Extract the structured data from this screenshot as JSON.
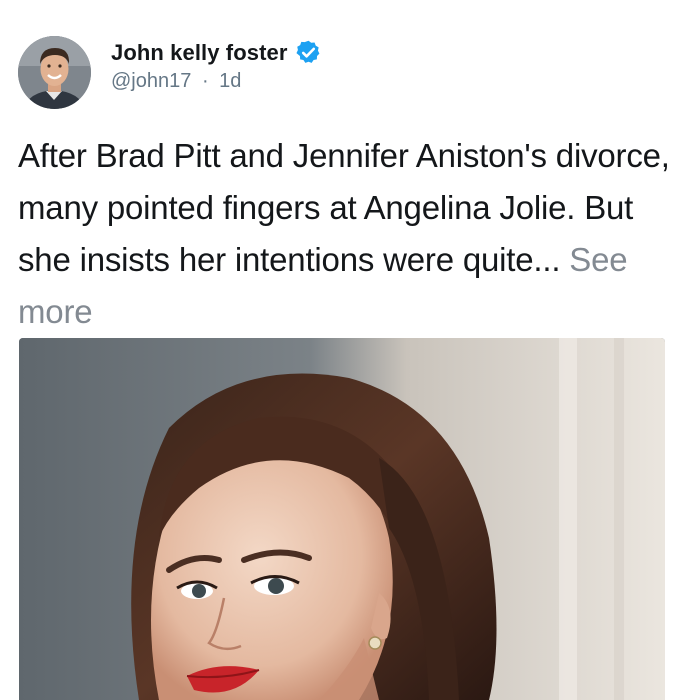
{
  "post": {
    "author": {
      "name": "John kelly foster",
      "verified": true,
      "handle": "@john17",
      "separator": "·",
      "time": "1d"
    },
    "text": "After Brad Pitt and Jennifer Aniston's divorce, many pointed fingers at Angelina Jolie. But she insists her intentions were quite...",
    "see_more_label": "See more",
    "colors": {
      "verified_badge": "#1da1f2",
      "secondary_text": "#657786",
      "see_more": "#838a92"
    },
    "icons": [
      "verified-icon"
    ]
  }
}
